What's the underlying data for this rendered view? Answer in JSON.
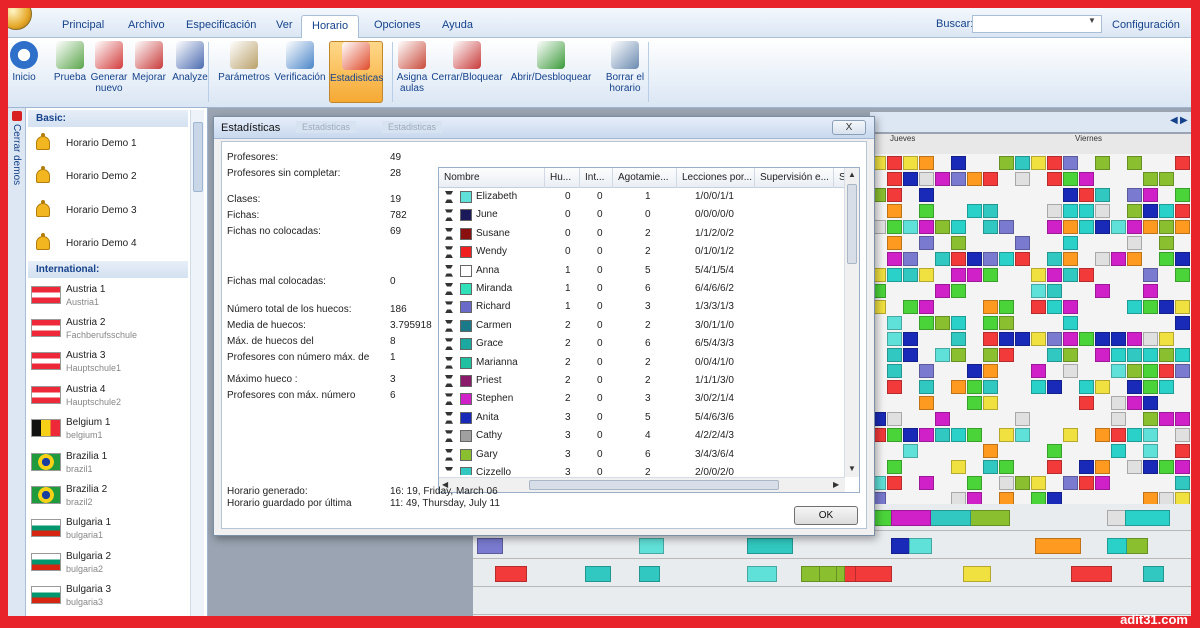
{
  "tabs": [
    "Principal",
    "Archivo",
    "Especificación",
    "Ver",
    "Horario",
    "Opciones",
    "Ayuda"
  ],
  "active_tab": "Horario",
  "search": {
    "label": "Buscar:",
    "value": ""
  },
  "config_label": "Configuración",
  "ribbon": [
    {
      "label": "Inicio",
      "icon": "back-arrow-icon",
      "color": "#2d6fc9"
    },
    {
      "label": "Prueba",
      "icon": "test-icon",
      "color": "#5aa54a"
    },
    {
      "label": "Generar nuevo",
      "icon": "generate-icon",
      "color": "#d33b3b"
    },
    {
      "label": "Mejorar",
      "icon": "improve-icon",
      "color": "#c83a3a"
    },
    {
      "label": "Analyze",
      "icon": "analyze-icon",
      "color": "#4a6bb0"
    },
    {
      "label": "Parámetros",
      "icon": "parameters-icon",
      "color": "#b9a06a"
    },
    {
      "label": "Verificación",
      "icon": "verify-icon",
      "color": "#4a86c8"
    },
    {
      "label": "Estadisticas",
      "icon": "statistics-icon",
      "color": "#e04a2a"
    },
    {
      "label": "Asigna aulas",
      "icon": "house-icon",
      "color": "#c84a3a"
    },
    {
      "label": "Cerrar/Bloquear",
      "icon": "lock-sheet-icon",
      "color": "#c83a3a"
    },
    {
      "label": "Abrir/Desbloquear",
      "icon": "unlock-sheet-icon",
      "color": "#3a9a3a"
    },
    {
      "label": "Borrar el horario",
      "icon": "trash-icon",
      "color": "#6a8ab0"
    }
  ],
  "sidebar": {
    "vertical_label": "Cerrar demos",
    "groups": [
      {
        "title": "Basic:",
        "items": [
          {
            "name": "Horario Demo 1",
            "sub": "",
            "icon": "bell"
          },
          {
            "name": "Horario Demo 2",
            "sub": "",
            "icon": "bell"
          },
          {
            "name": "Horario Demo 3",
            "sub": "",
            "icon": "bell"
          },
          {
            "name": "Horario Demo 4",
            "sub": "",
            "icon": "bell"
          }
        ]
      },
      {
        "title": "International:",
        "items": [
          {
            "name": "Austria 1",
            "sub": "Austria1",
            "icon": "flag-austria"
          },
          {
            "name": "Austria 2",
            "sub": "Fachberufsschule",
            "icon": "flag-austria"
          },
          {
            "name": "Austria 3",
            "sub": "Hauptschule1",
            "icon": "flag-austria"
          },
          {
            "name": "Austria 4",
            "sub": "Hauptschule2",
            "icon": "flag-austria"
          },
          {
            "name": "Belgium 1",
            "sub": "belgium1",
            "icon": "flag-belgium"
          },
          {
            "name": "Brazilia 1",
            "sub": "brazil1",
            "icon": "flag-brazil"
          },
          {
            "name": "Brazilia 2",
            "sub": "brazil2",
            "icon": "flag-brazil"
          },
          {
            "name": "Bulgaria 1",
            "sub": "bulgaria1",
            "icon": "flag-bulgaria"
          },
          {
            "name": "Bulgaria 2",
            "sub": "bulgaria2",
            "icon": "flag-bulgaria"
          },
          {
            "name": "Bulgaria 3",
            "sub": "bulgaria3",
            "icon": "flag-bulgaria"
          }
        ]
      }
    ]
  },
  "grid_days": [
    "Jueves",
    "Viernes"
  ],
  "dialog": {
    "title": "Estadísticas",
    "ghost_tabs": [
      "Estadisticas",
      "Estadisticas"
    ],
    "close": "X",
    "stats": [
      {
        "label": "Profesores:",
        "value": "49"
      },
      {
        "label": "Profesores sin completar:",
        "value": "28"
      },
      {
        "label": "Clases:",
        "value": "19"
      },
      {
        "label": "Fichas:",
        "value": "782"
      },
      {
        "label": "Fichas no colocadas:",
        "value": "69"
      },
      {
        "label": "Fichas mal colocadas:",
        "value": "0"
      },
      {
        "label": "Número total de los huecos:",
        "value": "186"
      },
      {
        "label": "Media de huecos:",
        "value": "3.795918"
      },
      {
        "label": "Máx. de huecos del",
        "value": "8"
      },
      {
        "label": "Profesores con número máx. de",
        "value": "1"
      },
      {
        "label": "Máximo hueco :",
        "value": "3"
      },
      {
        "label": "Profesores con máx. número",
        "value": "6"
      }
    ],
    "footer": [
      {
        "label": "Horario generado:",
        "value": "16: 19, Friday, March 06"
      },
      {
        "label": "Horario guardado por última",
        "value": "11: 49, Thursday, July 11"
      }
    ],
    "ok": "OK",
    "columns": [
      "Nombre",
      "Hu...",
      "Int...",
      "Agotamie...",
      "Lecciones por...",
      "Supervisión e...",
      "S"
    ],
    "rows": [
      {
        "name": "Elizabeth",
        "color": "#5fe0d8",
        "hu": "0",
        "int": "0",
        "ago": "1",
        "lec": "1/0/0/1/1"
      },
      {
        "name": "June",
        "color": "#1a1a5a",
        "hu": "0",
        "int": "0",
        "ago": "0",
        "lec": "0/0/0/0/0"
      },
      {
        "name": "Susane",
        "color": "#8a1010",
        "hu": "0",
        "int": "0",
        "ago": "2",
        "lec": "1/1/2/0/2"
      },
      {
        "name": "Wendy",
        "color": "#f02020",
        "hu": "0",
        "int": "0",
        "ago": "2",
        "lec": "0/1/0/1/2"
      },
      {
        "name": "Anna",
        "color": "#ffffff",
        "hu": "1",
        "int": "0",
        "ago": "5",
        "lec": "5/4/1/5/4"
      },
      {
        "name": "Miranda",
        "color": "#30e0b8",
        "hu": "1",
        "int": "0",
        "ago": "6",
        "lec": "6/4/6/6/2"
      },
      {
        "name": "Richard",
        "color": "#6a6ac8",
        "hu": "1",
        "int": "0",
        "ago": "3",
        "lec": "1/3/3/1/3"
      },
      {
        "name": "Carmen",
        "color": "#1a7a8a",
        "hu": "2",
        "int": "0",
        "ago": "2",
        "lec": "3/0/1/1/0"
      },
      {
        "name": "Grace",
        "color": "#1aa8a0",
        "hu": "2",
        "int": "0",
        "ago": "6",
        "lec": "6/5/4/3/3"
      },
      {
        "name": "Marianna",
        "color": "#20c0a0",
        "hu": "2",
        "int": "0",
        "ago": "2",
        "lec": "0/0/4/1/0"
      },
      {
        "name": "Priest",
        "color": "#8a1a6a",
        "hu": "2",
        "int": "0",
        "ago": "2",
        "lec": "1/1/1/3/0"
      },
      {
        "name": "Stephen",
        "color": "#d020c8",
        "hu": "2",
        "int": "0",
        "ago": "3",
        "lec": "3/0/2/1/4"
      },
      {
        "name": "Anita",
        "color": "#1a2ab8",
        "hu": "3",
        "int": "0",
        "ago": "5",
        "lec": "5/4/6/3/6"
      },
      {
        "name": "Cathy",
        "color": "#a0a0a0",
        "hu": "3",
        "int": "0",
        "ago": "4",
        "lec": "4/2/2/4/3"
      },
      {
        "name": "Gary",
        "color": "#8ac030",
        "hu": "3",
        "int": "0",
        "ago": "6",
        "lec": "3/4/3/6/4"
      },
      {
        "name": "Cizzello",
        "color": "#30c8c0",
        "hu": "3",
        "int": "0",
        "ago": "2",
        "lec": "2/0/0/2/0"
      }
    ]
  },
  "watermark": "adit31.com"
}
